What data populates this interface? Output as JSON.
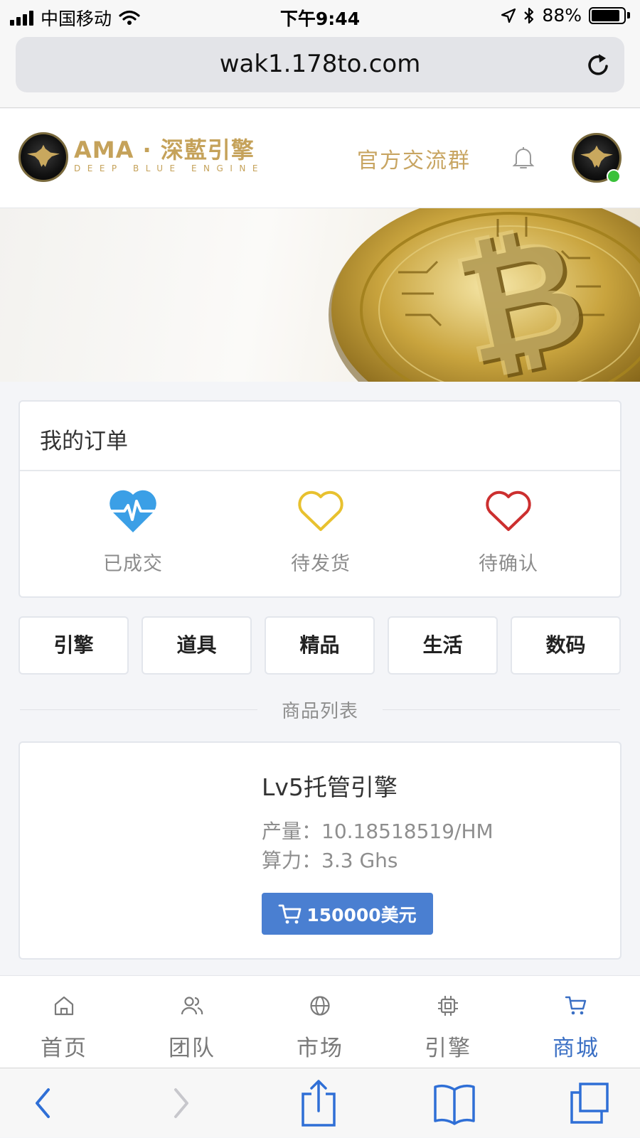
{
  "status_bar": {
    "carrier": "中国移动",
    "time": "下午9:44",
    "battery_percent": "88%",
    "battery_level": 0.88
  },
  "browser": {
    "url": "wak1.178to.com"
  },
  "header": {
    "brand_title": "AMA · 深藍引擎",
    "brand_subtitle": "DEEP BLUE ENGINE",
    "group_link": "官方交流群",
    "brand_color": "#c5a25a"
  },
  "orders": {
    "title": "我的订单",
    "items": [
      {
        "label": "已成交",
        "icon": "pulse-heart-icon",
        "color": "#3b9fe6"
      },
      {
        "label": "待发货",
        "icon": "heart-outline-icon",
        "color": "#e8c12f"
      },
      {
        "label": "待确认",
        "icon": "heart-outline-icon",
        "color": "#cc2f2f"
      }
    ]
  },
  "categories": {
    "tabs": [
      "引擎",
      "道具",
      "精品",
      "生活",
      "数码"
    ],
    "active_index": 0,
    "active_color": "#3a6fc4"
  },
  "product_list": {
    "title": "商品列表",
    "products": [
      {
        "name": "Lv5托管引擎",
        "output_label": "产量：",
        "output_value": "10.18518519/HM",
        "power_label": "算力：",
        "power_value": "3.3 Ghs",
        "price_label": "150000美元"
      }
    ]
  },
  "bottom_nav": {
    "items": [
      {
        "label": "首页",
        "icon": "home-icon"
      },
      {
        "label": "团队",
        "icon": "team-icon"
      },
      {
        "label": "市场",
        "icon": "globe-icon"
      },
      {
        "label": "引擎",
        "icon": "chip-icon"
      },
      {
        "label": "商城",
        "icon": "cart-icon"
      }
    ],
    "active_index": 4
  }
}
